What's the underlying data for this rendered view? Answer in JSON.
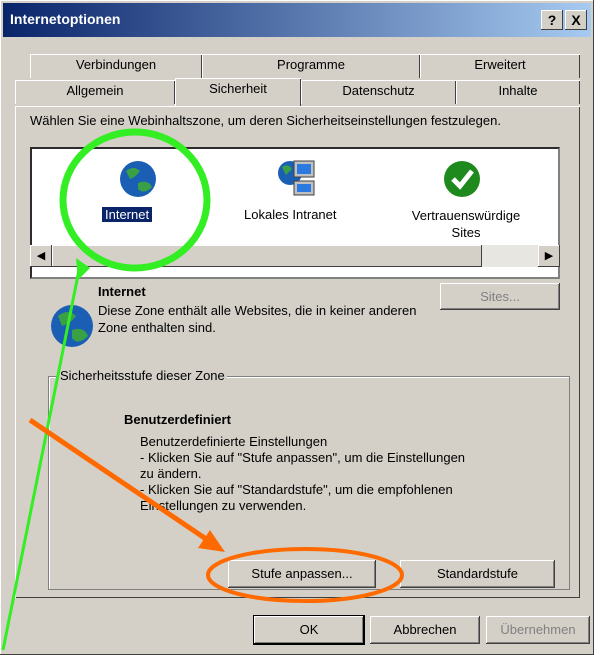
{
  "window": {
    "title": "Internetoptionen",
    "help_btn": "?",
    "close_btn": "X"
  },
  "tabs": {
    "row_back": [
      "Verbindungen",
      "Programme",
      "Erweitert"
    ],
    "row_front": [
      "Allgemein",
      "Sicherheit",
      "Datenschutz",
      "Inhalte"
    ],
    "active": "Sicherheit"
  },
  "zone_intro": "Wählen Sie eine Webinhaltszone, um deren Sicherheitseinstellungen festzulegen.",
  "zones": [
    {
      "label": "Internet",
      "icon": "globe-icon",
      "selected": true
    },
    {
      "label": "Lokales Intranet",
      "icon": "intranet-computer-icon",
      "selected": false
    },
    {
      "label": "Vertrauenswürdige Sites",
      "icon": "green-check-icon",
      "selected": false
    }
  ],
  "zone_detail": {
    "title": "Internet",
    "description": "Diese Zone enthält alle Websites, die in keiner anderen Zone enthalten sind.",
    "sites_button": "Sites..."
  },
  "security_level": {
    "group_label": "Sicherheitsstufe dieser Zone",
    "heading": "Benutzerdefiniert",
    "lines": [
      "Benutzerdefinierte Einstellungen",
      "- Klicken Sie auf \"Stufe anpassen\", um die Einstellungen",
      "zu ändern.",
      "- Klicken Sie auf \"Standardstufe\", um die empfohlenen",
      "Einstellungen zu verwenden."
    ],
    "custom_button": "Stufe anpassen...",
    "default_button": "Standardstufe"
  },
  "footer": {
    "ok": "OK",
    "cancel": "Abbrechen",
    "apply": "Übernehmen"
  },
  "colors": {
    "highlight_circle": "#33ee22",
    "highlight_ellipse": "#ff6a00",
    "selection": "#0a246a"
  }
}
